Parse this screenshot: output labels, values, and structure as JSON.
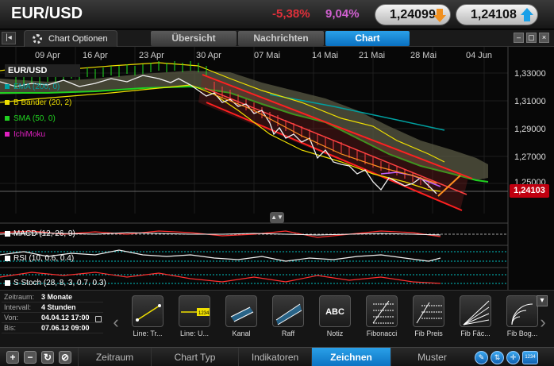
{
  "header": {
    "pair": "EUR/USD",
    "change_pct": "-5,38%",
    "change_pct_2": "9,04%",
    "bid": "1,24099",
    "ask": "1,24108"
  },
  "tabs": {
    "chart_options": "Chart Optionen",
    "items": [
      "Übersicht",
      "Nachrichten",
      "Chart"
    ],
    "active": "Chart"
  },
  "chart": {
    "dates": [
      "09 Apr",
      "16 Apr",
      "23 Apr",
      "30 Apr",
      "07 Mai",
      "14 Mai",
      "21 Mai",
      "28 Mai",
      "04 Jun"
    ],
    "prices": [
      "1,33000",
      "1,31000",
      "1,29000",
      "1,27000",
      "1,25000"
    ],
    "last_price": "1,24103",
    "legend_title": "EUR/USD",
    "legend": [
      {
        "label": "EMA (200, 0)",
        "color": "#00a0a0"
      },
      {
        "label": "B Bänder (20, 2)",
        "color": "#f0e000"
      },
      {
        "label": "SMA (50, 0)",
        "color": "#20d020"
      },
      {
        "label": "IchiMoku",
        "color": "#e020c0"
      }
    ],
    "indicators": [
      "MACD (12, 26, 9)",
      "RSI (10, 0.6, 0.4)",
      "S Stoch (28, 8, 3, 0.7, 0.3)"
    ]
  },
  "info": {
    "zeitraum_key": "Zeitraum:",
    "zeitraum_val": "3 Monate",
    "intervall_key": "Intervall:",
    "intervall_val": "4 Stunden",
    "von_key": "Von:",
    "von_val": "04.04.12 17:00",
    "bis_key": "Bis:",
    "bis_val": "07.06.12 09:00"
  },
  "tools": [
    {
      "label": "Line: Tr...",
      "icon": "trendline-icon"
    },
    {
      "label": "Line: U...",
      "icon": "horizontal-line-icon"
    },
    {
      "label": "Kanal",
      "icon": "channel-icon"
    },
    {
      "label": "Raff",
      "icon": "raff-channel-icon"
    },
    {
      "label": "Notiz",
      "icon": "note-icon"
    },
    {
      "label": "Fibonacci",
      "icon": "fibonacci-icon"
    },
    {
      "label": "Fib Preis",
      "icon": "fib-price-icon"
    },
    {
      "label": "Fib Fäc...",
      "icon": "fib-fan-icon"
    },
    {
      "label": "Fib Bog...",
      "icon": "fib-arc-icon"
    }
  ],
  "note_icon_text": "ABC",
  "line_u_icon_text": "1234",
  "bottom_tabs": [
    "Zeitraum",
    "Chart Typ",
    "Indikatoren",
    "Zeichnen",
    "Muster"
  ],
  "bottom_active": "Zeichnen",
  "badge_1234": "1234"
}
